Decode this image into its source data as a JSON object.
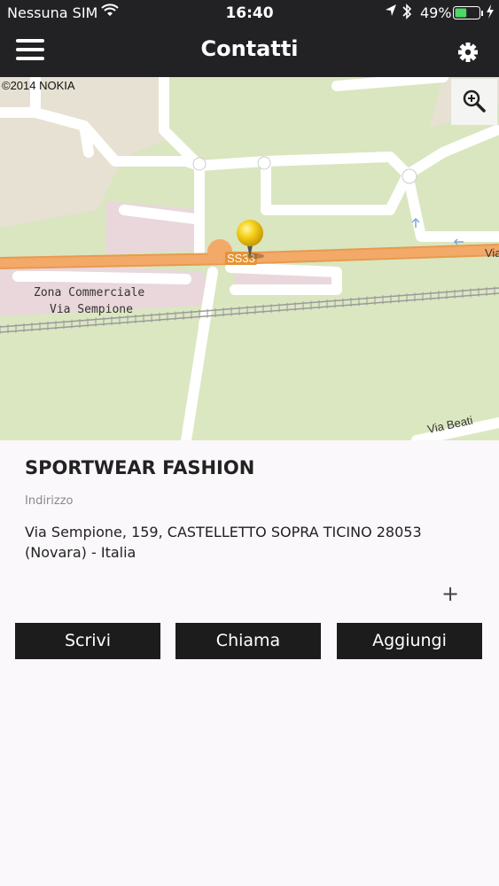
{
  "status_bar": {
    "carrier": "Nessuna SIM",
    "time": "16:40",
    "battery_percent": "49%",
    "battery_level": 0.49
  },
  "header": {
    "title": "Contatti",
    "menu_icon": "hamburger-menu-icon",
    "settings_icon": "gear-icon"
  },
  "map": {
    "copyright": "©2014 NOKIA",
    "labels": {
      "zone_line1": "Zona Commerciale",
      "zone_line2": "Via Sempione",
      "road_shield": "SS33",
      "road_right": "Via",
      "road_bottom": "Via Beati"
    },
    "zoom_icon": "zoom-in-icon",
    "pin_icon": "map-pin-icon"
  },
  "contact": {
    "name": "SPORTWEAR FASHION",
    "address_label": "Indirizzo",
    "address": "Via Sempione, 159, CASTELLETTO SOPRA TICINO 28053 (Novara) - Italia",
    "expand_label": "+"
  },
  "actions": {
    "write": "Scrivi",
    "call": "Chiama",
    "add": "Aggiungi"
  },
  "colors": {
    "header_bg": "#222224",
    "map_road_main": "#f2a560",
    "map_green": "#d9e6bf",
    "button_bg": "#1c1c1c"
  }
}
